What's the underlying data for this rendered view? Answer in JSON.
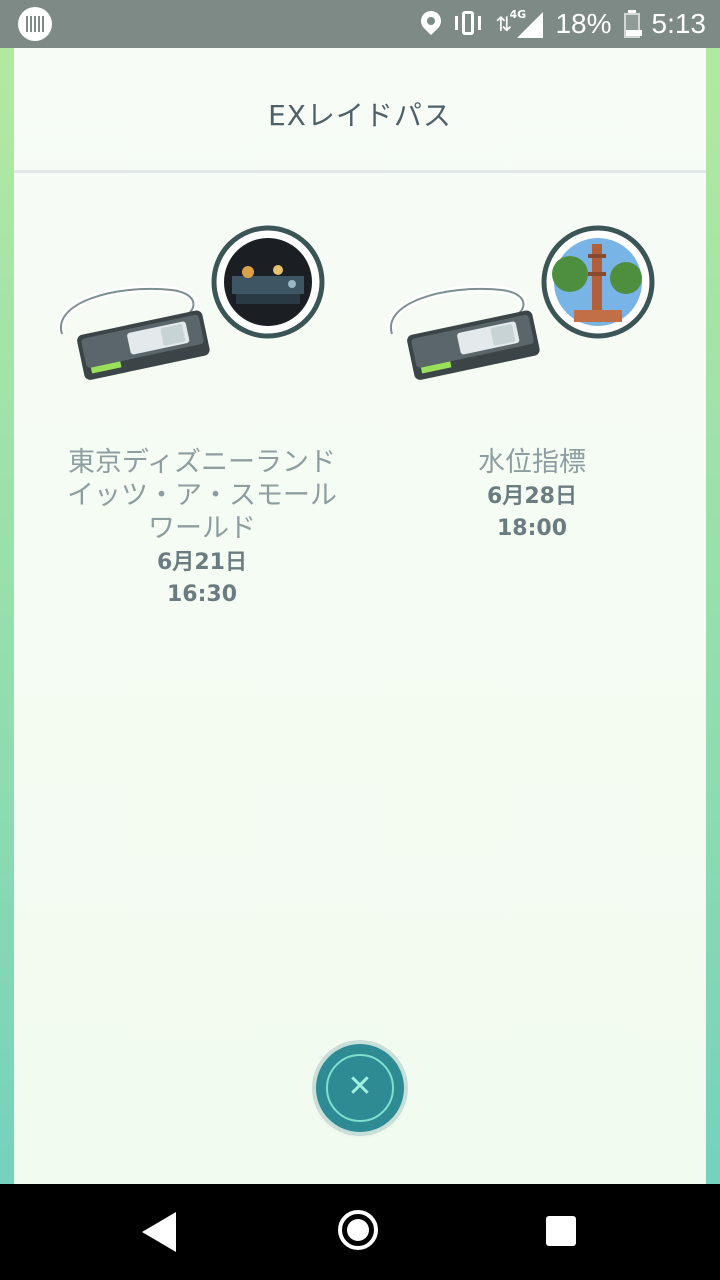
{
  "status_bar": {
    "battery_percent": "18%",
    "time": "5:13",
    "network_label": "4G",
    "icons": [
      "notification-icon",
      "location-icon",
      "vibrate-icon",
      "network-4g-icon",
      "signal-icon",
      "battery-icon"
    ]
  },
  "header": {
    "title": "EXレイドパス"
  },
  "passes": [
    {
      "location_line1": "東京ディズニーランド",
      "location_line2": "イッツ・ア・スモール",
      "location_line3": "ワールド",
      "date": "6月21日",
      "time": "16:30"
    },
    {
      "location_line1": "水位指標",
      "date": "6月28日",
      "time": "18:00"
    }
  ],
  "close_button": {
    "icon": "close-icon"
  },
  "nav_bar": {
    "icons": [
      "back-icon",
      "home-icon",
      "recents-icon"
    ]
  },
  "colors": {
    "accent_teal": "#2e8a93",
    "title_text": "#4f6168",
    "location_text": "#8e9ea0"
  }
}
